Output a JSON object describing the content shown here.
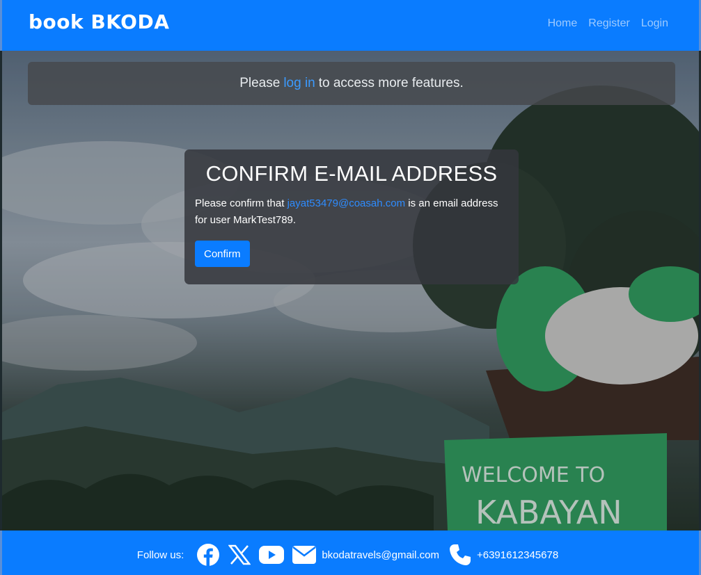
{
  "navbar": {
    "brand": "book BKODA",
    "links": [
      "Home",
      "Register",
      "Login"
    ]
  },
  "alert": {
    "prefix": "Please",
    "link": "log in",
    "suffix": "to access more features."
  },
  "card": {
    "title": "CONFIRM E-MAIL ADDRESS",
    "text_before": "Please confirm that",
    "email": "jayat53479@coasah.com",
    "text_after": "is an email address for user MarkTest789.",
    "button": "Confirm"
  },
  "background": {
    "sign_text_line1": "WELCOME TO",
    "sign_text_line2": "KABAYAN"
  },
  "footer": {
    "follow_label": "Follow us:",
    "social_icons": [
      "facebook-icon",
      "x-icon",
      "youtube-icon"
    ],
    "email_icon": "envelope-icon",
    "email": "bkodatravels@gmail.com",
    "phone_icon": "phone-icon",
    "phone": "+6391612345678"
  },
  "colors": {
    "primary": "#0a7cff",
    "link": "#2e8cff"
  }
}
